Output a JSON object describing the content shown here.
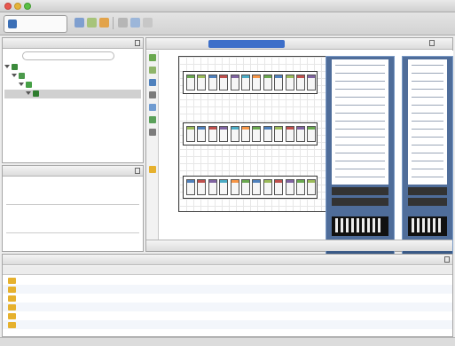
{
  "window": {
    "title": ""
  },
  "toolbar": {
    "perspective_label": "",
    "search_placeholder": ""
  },
  "left_top": {
    "tabs": [
      "",
      ""
    ],
    "filter_label": "",
    "filter_placeholder": "",
    "filter_button": "",
    "tree": [
      {
        "label": "",
        "level": 0,
        "icon_color": "#3b8a3b"
      },
      {
        "label": "",
        "level": 1,
        "icon_color": "#4c9a4c"
      },
      {
        "label": "",
        "level": 2,
        "icon_color": "#46a046"
      },
      {
        "label": "",
        "level": 3,
        "icon_color": "#2f7d2f",
        "selected": true
      }
    ]
  },
  "left_bottom": {
    "tabs": [
      "",
      ""
    ],
    "intro": "",
    "section1_head": "",
    "section1_text": "",
    "section2_head": "",
    "section2_text": ""
  },
  "editor": {
    "tabs": [
      "",
      ""
    ],
    "active_tab": "",
    "bottom_tabs": [
      "",
      "",
      "",
      ""
    ],
    "rack_left_label": "",
    "rack_right_label": ""
  },
  "bottom": {
    "tabs": [
      "",
      "",
      "",
      ""
    ],
    "columns": [
      "",
      "",
      "",
      "",
      ""
    ],
    "rows": [
      [
        "",
        "",
        "",
        "",
        ""
      ],
      [
        "",
        "",
        "",
        "",
        ""
      ],
      [
        "",
        "",
        "",
        "",
        ""
      ],
      [
        "",
        "",
        "",
        "",
        ""
      ],
      [
        "",
        "",
        "",
        "",
        ""
      ],
      [
        "",
        "",
        "",
        "",
        ""
      ]
    ]
  },
  "status": {
    "right_text": ""
  },
  "colors": {
    "accent": "#3d6fc9",
    "rack_frame": "#4f6d9a",
    "folder": "#e6b12e",
    "bay_colors": [
      "#6aa84f",
      "#9bbb59",
      "#4f81bd",
      "#c0504d",
      "#8064a2",
      "#4bacc6",
      "#f79646",
      "#6aa84f",
      "#4f81bd",
      "#9bbb59",
      "#c0504d",
      "#8064a2"
    ]
  }
}
